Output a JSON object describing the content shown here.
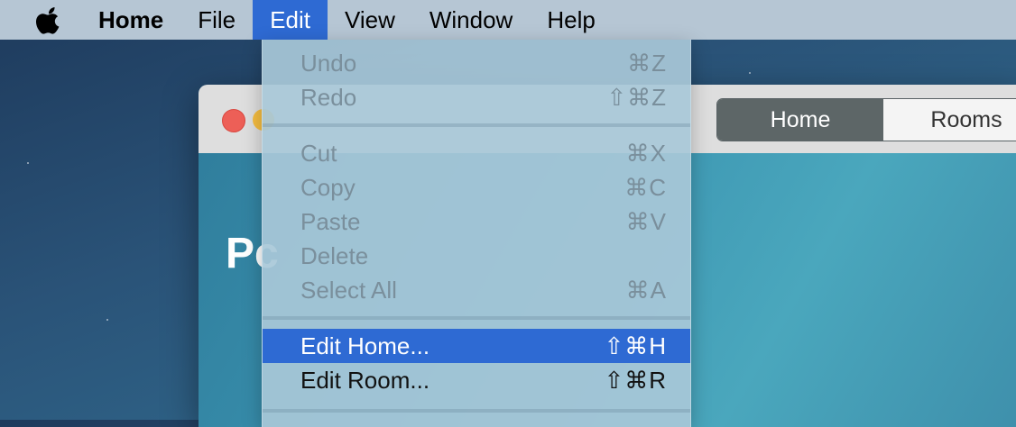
{
  "menubar": {
    "app_name": "Home",
    "menus": [
      "File",
      "Edit",
      "View",
      "Window",
      "Help"
    ]
  },
  "edit_menu": {
    "items": [
      {
        "label": "Undo",
        "shortcut": "⌘Z"
      },
      {
        "label": "Redo",
        "shortcut": "⇧⌘Z"
      },
      {
        "label": "Cut",
        "shortcut": "⌘X"
      },
      {
        "label": "Copy",
        "shortcut": "⌘C"
      },
      {
        "label": "Paste",
        "shortcut": "⌘V"
      },
      {
        "label": "Delete",
        "shortcut": ""
      },
      {
        "label": "Select All",
        "shortcut": "⌘A"
      },
      {
        "label": "Edit Home...",
        "shortcut": "⇧⌘H"
      },
      {
        "label": "Edit Room...",
        "shortcut": "⇧⌘R"
      }
    ]
  },
  "window": {
    "tabs": [
      "Home",
      "Rooms"
    ],
    "heading_partial": "Pc"
  },
  "colors": {
    "highlight": "#2e6ad3",
    "close_button": "#ed5f57",
    "minimize_button": "#f5bd40"
  }
}
